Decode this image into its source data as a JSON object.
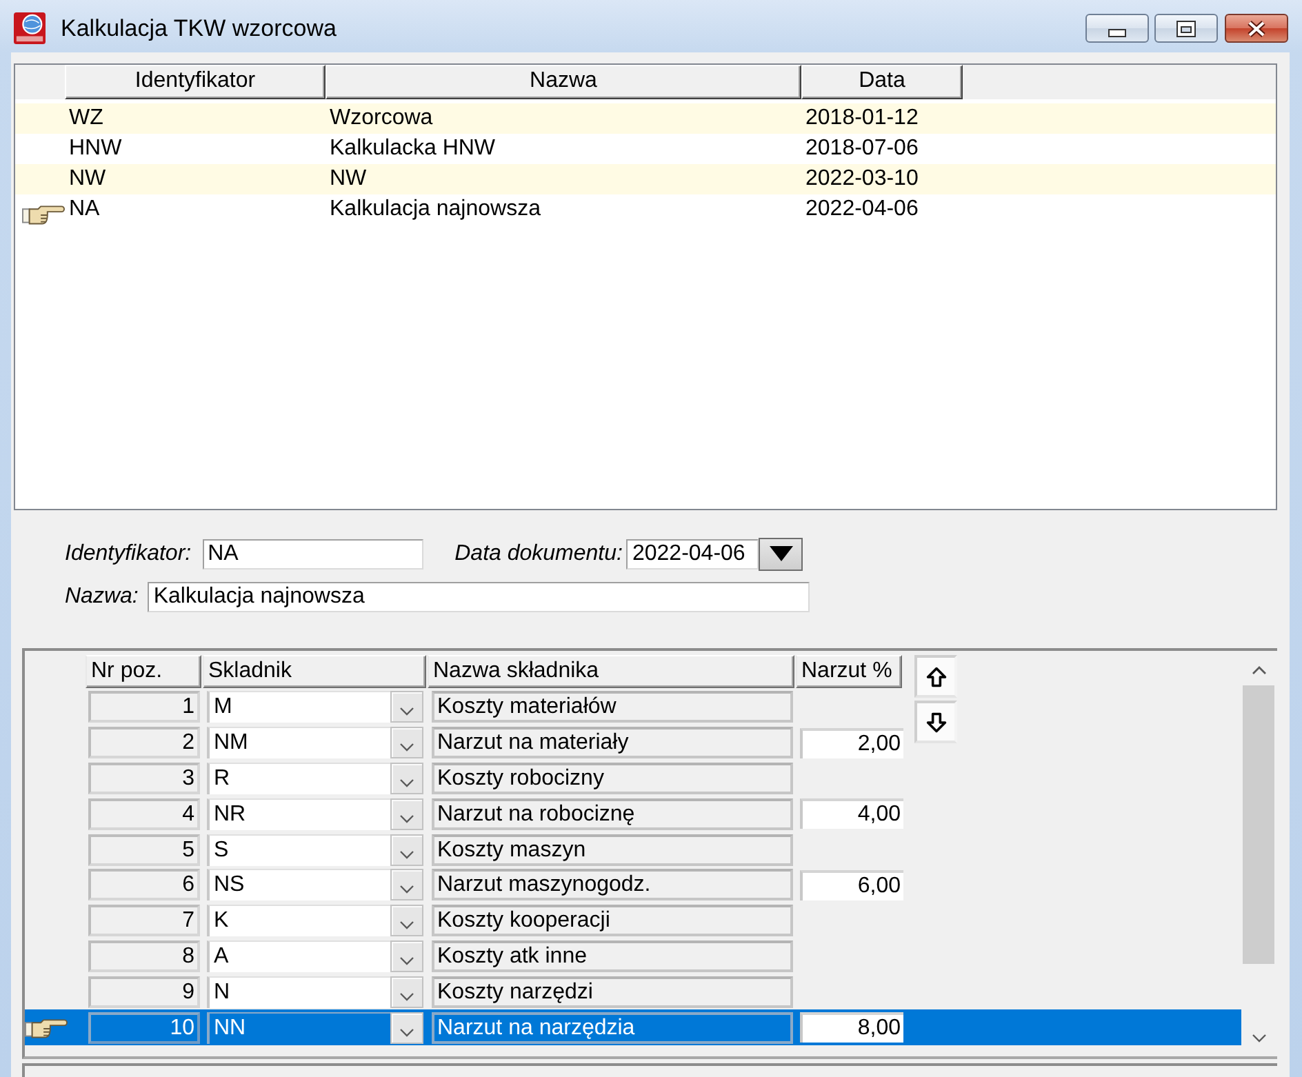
{
  "window": {
    "title": "Kalkulacja TKW wzorcowa"
  },
  "documents": {
    "columns": [
      "Identyfikator",
      "Nazwa",
      "Data"
    ],
    "rows": [
      {
        "cells": [
          "WZ",
          "Wzorcowa",
          "2018-01-12"
        ],
        "selected": false
      },
      {
        "cells": [
          "HNW",
          "Kalkulacka HNW",
          "2018-07-06"
        ],
        "selected": false
      },
      {
        "cells": [
          "NW",
          "NW",
          "2022-03-10"
        ],
        "selected": false
      },
      {
        "cells": [
          "NA",
          "Kalkulacja najnowsza",
          "2022-04-06"
        ],
        "selected": true
      }
    ]
  },
  "form": {
    "identyfikator": {
      "label": "Identyfikator:",
      "value": "NA"
    },
    "data_dokumentu": {
      "label": "Data dokumentu:",
      "value": "2022-04-06"
    },
    "nazwa": {
      "label": "Nazwa:",
      "value": "Kalkulacja najnowsza"
    }
  },
  "components": {
    "columns": [
      "Nr poz.",
      "Skladnik",
      "Nazwa składnika",
      "Narzut %"
    ],
    "rows": [
      {
        "nr": "1",
        "code": "M",
        "name": "Koszty materiałów",
        "selected": false
      },
      {
        "nr": "2",
        "code": "NM",
        "name": "Narzut na materiały",
        "markup": "2,00",
        "selected": false
      },
      {
        "nr": "3",
        "code": "R",
        "name": "Koszty robocizny",
        "selected": false
      },
      {
        "nr": "4",
        "code": "NR",
        "name": "Narzut na robociznę",
        "markup": "4,00",
        "selected": false
      },
      {
        "nr": "5",
        "code": "S",
        "name": "Koszty maszyn",
        "selected": false
      },
      {
        "nr": "6",
        "code": "NS",
        "name": "Narzut maszynogodz.",
        "markup": "6,00",
        "selected": false
      },
      {
        "nr": "7",
        "code": "K",
        "name": "Koszty kooperacji",
        "selected": false
      },
      {
        "nr": "8",
        "code": "A",
        "name": "Koszty atk inne",
        "selected": false
      },
      {
        "nr": "9",
        "code": "N",
        "name": "Koszty narzędzi",
        "selected": false
      },
      {
        "nr": "10",
        "code": "NN",
        "name": "Narzut na narzędzia",
        "markup": "8,00",
        "selected": true
      }
    ]
  }
}
